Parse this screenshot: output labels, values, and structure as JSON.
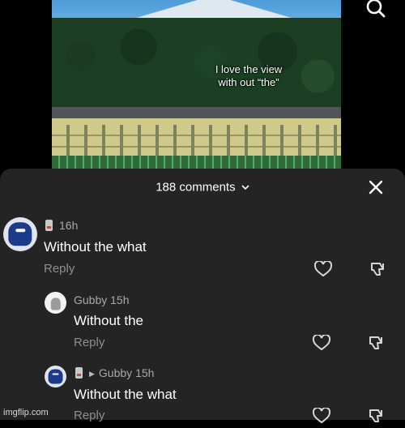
{
  "video": {
    "caption_line1": "I love the view",
    "caption_line2": "with out “the”",
    "search_icon": "search-icon"
  },
  "sheet": {
    "title": "188 comments",
    "close_icon": "close-icon"
  },
  "comments": [
    {
      "meta": "16h",
      "text": "Without the what",
      "reply": "Reply"
    },
    {
      "author": "Gubby",
      "meta": "15h",
      "text": "Without the",
      "reply": "Reply"
    },
    {
      "author": "Gubby",
      "meta": "15h",
      "text": "Without the what",
      "reply": "Reply"
    }
  ],
  "watermark": "imgflip.com"
}
